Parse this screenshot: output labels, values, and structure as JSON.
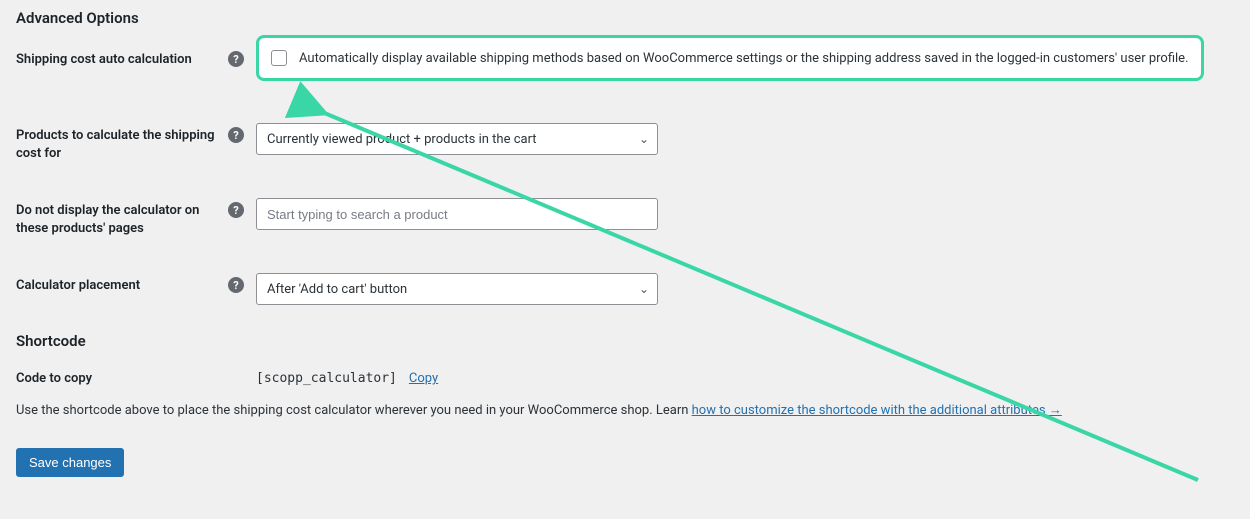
{
  "sections": {
    "advanced_title": "Advanced Options",
    "shortcode_title": "Shortcode"
  },
  "rows": {
    "auto_calc": {
      "label": "Shipping cost auto calculation",
      "checkbox_label": "Automatically display available shipping methods based on WooCommerce settings or the shipping address saved in the logged-in customers' user profile."
    },
    "products_calc": {
      "label": "Products to calculate the shipping cost for",
      "selected": "Currently viewed product + products in the cart"
    },
    "exclude": {
      "label": "Do not display the calculator on these products' pages",
      "placeholder": "Start typing to search a product"
    },
    "placement": {
      "label": "Calculator placement",
      "selected": "After 'Add to cart' button"
    },
    "code": {
      "label": "Code to copy",
      "shortcode": "[scopp_calculator]",
      "copy": "Copy"
    }
  },
  "desc": {
    "pre": "Use the shortcode above to place the shipping cost calculator wherever you need in your WooCommerce shop. Learn ",
    "link": "how to customize the shortcode with the additional attributes →"
  },
  "buttons": {
    "save": "Save changes"
  },
  "colors": {
    "highlight": "#3ad6a5",
    "primary": "#2271b1"
  }
}
